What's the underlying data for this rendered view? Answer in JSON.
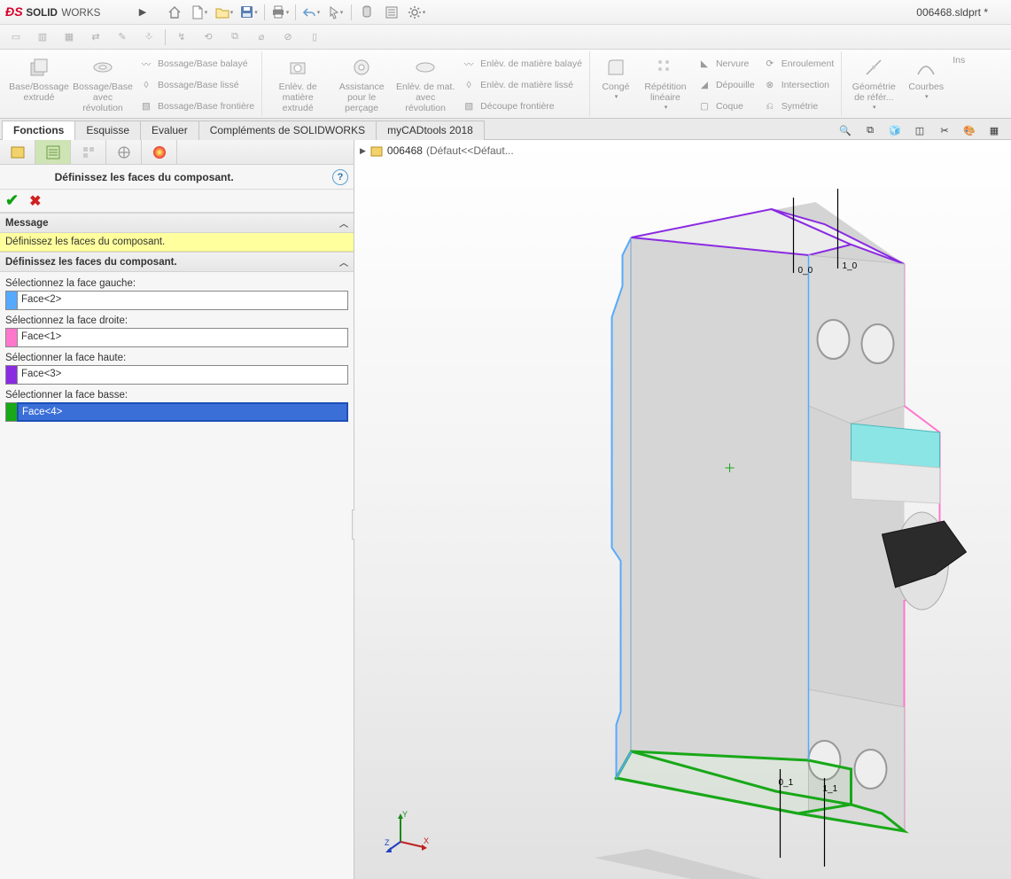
{
  "app_name_bold": "SOLID",
  "app_name_light": "WORKS",
  "document_title": "006468.sldprt *",
  "ribbon": {
    "groups": [
      {
        "big": [
          {
            "label": "Base/Bossage extrudé"
          },
          {
            "label": "Bossage/Base avec révolution"
          }
        ],
        "small": [
          {
            "label": "Bossage/Base balayé"
          },
          {
            "label": "Bossage/Base lissé"
          },
          {
            "label": "Bossage/Base frontière"
          }
        ]
      },
      {
        "big": [
          {
            "label": "Enlèv. de matière extrudé"
          },
          {
            "label": "Assistance pour le perçage"
          },
          {
            "label": "Enlèv. de mat. avec révolution"
          }
        ],
        "small": [
          {
            "label": "Enlèv. de matière balayé"
          },
          {
            "label": "Enlèv. de matière lissé"
          },
          {
            "label": "Découpe frontière"
          }
        ]
      },
      {
        "big": [
          {
            "label": "Congé"
          },
          {
            "label": "Répétition linéaire"
          }
        ],
        "small": [
          {
            "label": "Nervure"
          },
          {
            "label": "Dépouille"
          },
          {
            "label": "Coque"
          }
        ],
        "small2": [
          {
            "label": "Enroulement"
          },
          {
            "label": "Intersection"
          },
          {
            "label": "Symétrie"
          }
        ]
      },
      {
        "big": [
          {
            "label": "Géométrie de référ..."
          },
          {
            "label": "Courbes"
          },
          {
            "label": "Ins"
          }
        ]
      }
    ]
  },
  "tabs": [
    "Fonctions",
    "Esquisse",
    "Evaluer",
    "Compléments de SOLIDWORKS",
    "myCADtools 2018"
  ],
  "active_tab": "Fonctions",
  "crumb_part": "006468",
  "crumb_config": "(Défaut<<Défaut...",
  "pm": {
    "title": "Définissez les faces du composant.",
    "section_message_hdr": "Message",
    "section_message_body": "Définissez les faces du composant.",
    "section_faces_hdr": "Définissez les faces du composant.",
    "label_left": "Sélectionnez la face gauche:",
    "value_left": "Face<2>",
    "label_right": "Sélectionnez la face droite:",
    "value_right": "Face<1>",
    "label_top": "Sélectionner la face haute:",
    "value_top": "Face<3>",
    "label_bottom": "Sélectionner la face basse:",
    "value_bottom": "Face<4>"
  },
  "annotations": {
    "top1": "0_0",
    "top2": "1_0",
    "bot1": "0_1",
    "bot2": "1_1"
  },
  "colors": {
    "left_face": "#55aaff",
    "right_face": "#ff77cc",
    "top_face": "#8a2be2",
    "bottom_face": "#18a818"
  }
}
